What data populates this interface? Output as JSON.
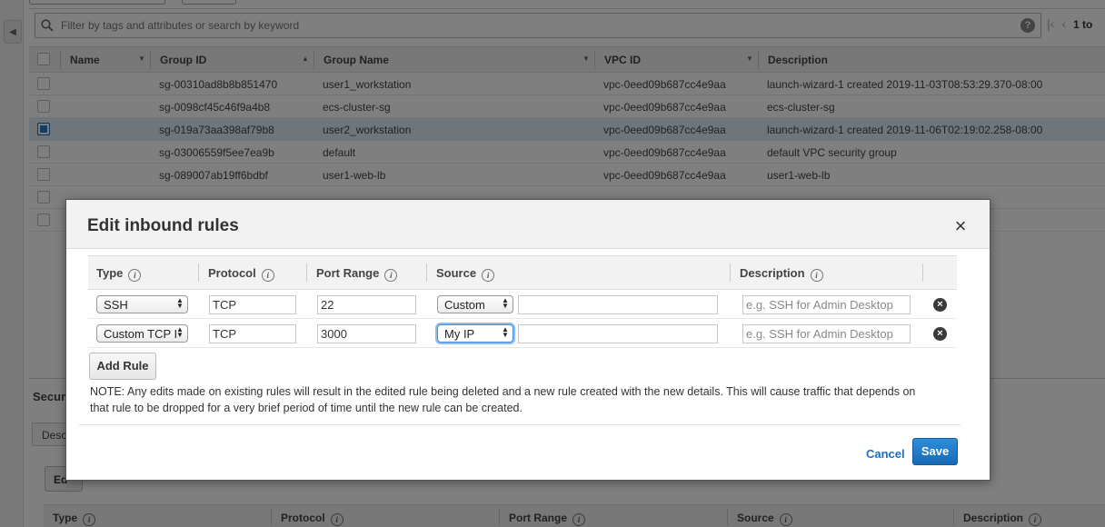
{
  "filter": {
    "placeholder": "Filter by tags and attributes or search by keyword",
    "help": "?",
    "pager_count": "1 to"
  },
  "grid": {
    "headers": {
      "name": "Name",
      "group_id": "Group ID",
      "group_name": "Group Name",
      "vpc_id": "VPC ID",
      "description": "Description"
    },
    "rows": [
      {
        "group_id": "sg-00310ad8b8b851470",
        "group_name": "user1_workstation",
        "vpc_id": "vpc-0eed09b687cc4e9aa",
        "description": "launch-wizard-1 created 2019-11-03T08:53:29.370-08:00",
        "selected": false
      },
      {
        "group_id": "sg-0098cf45c46f9a4b8",
        "group_name": "ecs-cluster-sg",
        "vpc_id": "vpc-0eed09b687cc4e9aa",
        "description": "ecs-cluster-sg",
        "selected": false
      },
      {
        "group_id": "sg-019a73aa398af79b8",
        "group_name": "user2_workstation",
        "vpc_id": "vpc-0eed09b687cc4e9aa",
        "description": "launch-wizard-1 created 2019-11-06T02:19:02.258-08:00",
        "selected": true
      },
      {
        "group_id": "sg-03006559f5ee7ea9b",
        "group_name": "default",
        "vpc_id": "vpc-0eed09b687cc4e9aa",
        "description": "default VPC security group",
        "selected": false
      },
      {
        "group_id": "sg-089007ab19ff6bdbf",
        "group_name": "user1-web-lb",
        "vpc_id": "vpc-0eed09b687cc4e9aa",
        "description": "user1-web-lb",
        "selected": false
      }
    ]
  },
  "bottom": {
    "section_label": "Secur",
    "tab_label": "Desc",
    "edit_label": "Ed",
    "headers": {
      "type": "Type",
      "protocol": "Protocol",
      "port_range": "Port Range",
      "source": "Source",
      "description": "Description"
    }
  },
  "modal": {
    "title": "Edit inbound rules",
    "close": "×",
    "headers": {
      "type": "Type",
      "protocol": "Protocol",
      "port_range": "Port Range",
      "source": "Source",
      "description": "Description"
    },
    "rules": [
      {
        "type": "SSH",
        "protocol": "TCP",
        "port_range": "22",
        "source": "Custom",
        "source_value": "",
        "description_placeholder": "e.g. SSH for Admin Desktop"
      },
      {
        "type": "Custom TCP I",
        "protocol": "TCP",
        "port_range": "3000",
        "source": "My IP",
        "source_value": "",
        "description_placeholder": "e.g. SSH for Admin Desktop"
      }
    ],
    "add_rule": "Add Rule",
    "note": "NOTE: Any edits made on existing rules will result in the edited rule being deleted and a new rule created with the new details. This will cause traffic that depends on that rule to be dropped for a very brief period of time until the new rule can be created.",
    "cancel": "Cancel",
    "save": "Save"
  },
  "colors": {
    "primary_button": "#1769b5",
    "link": "#1a6fc6",
    "selected_row": "#dcecf7"
  }
}
